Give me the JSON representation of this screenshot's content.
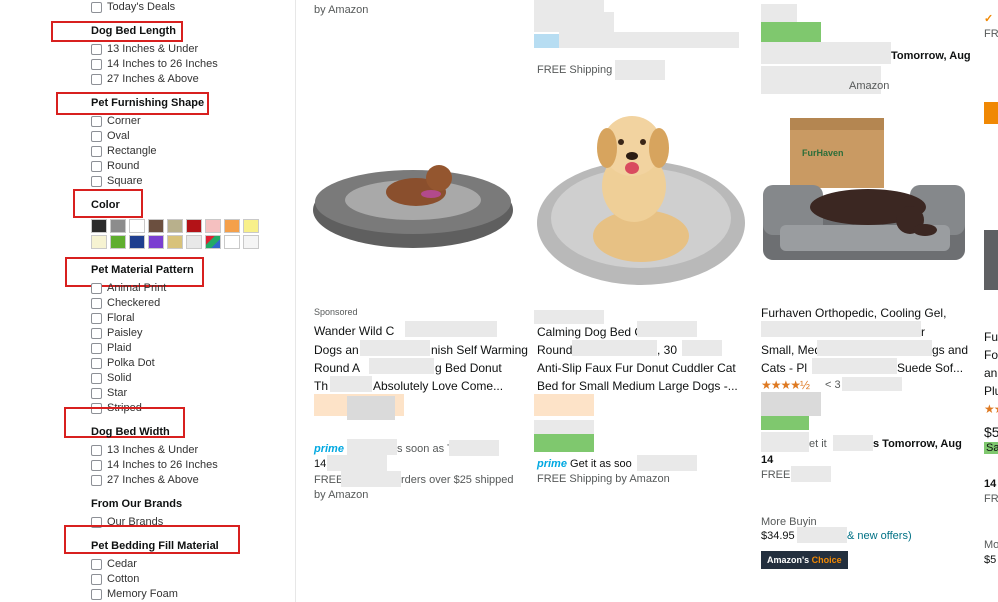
{
  "sidebar": {
    "top_item": "Today's Deals",
    "dog_bed_length": {
      "title": "Dog Bed Length",
      "options": [
        "13 Inches & Under",
        "14 Inches to 26 Inches",
        "27 Inches & Above"
      ]
    },
    "pet_furnishing_shape": {
      "title": "Pet Furnishing Shape",
      "options": [
        "Corner",
        "Oval",
        "Rectangle",
        "Round",
        "Square"
      ]
    },
    "color": {
      "title": "Color",
      "swatches_row1": [
        "#2b2b2b",
        "#8c8c8c",
        "#ffffff",
        "#6b4f3f",
        "#b8b08c",
        "#b31217",
        "#f5c0c0",
        "#f4a04a",
        "#f8f08a"
      ],
      "swatches_row2": [
        "#f6f3d2",
        "#5fae2e",
        "#1f3f8f",
        "#7a3fd1",
        "#d8c27a",
        "#e8e8e8",
        "#multi",
        "#ffffff",
        "#f5f5f5"
      ]
    },
    "pet_material_pattern": {
      "title": "Pet Material Pattern",
      "options": [
        "Animal Print",
        "Checkered",
        "Floral",
        "Paisley",
        "Plaid",
        "Polka Dot",
        "Solid",
        "Star",
        "Striped"
      ]
    },
    "dog_bed_width": {
      "title": "Dog Bed Width",
      "options": [
        "13 Inches & Under",
        "14 Inches to 26 Inches",
        "27 Inches & Above"
      ]
    },
    "from_our_brands": {
      "title": "From Our Brands",
      "options": [
        "Our Brands"
      ]
    },
    "pet_bedding_fill_material": {
      "title": "Pet Bedding Fill Material",
      "options": [
        "Cedar",
        "Cotton",
        "Memory Foam"
      ]
    }
  },
  "results": {
    "card1": {
      "top_text": "by Amazon",
      "sponsored": "Sponsored",
      "title_lines": [
        "Wander Wild C",
        "Dogs an",
        "nish Self Warming",
        "Round A",
        "g Bed Donut",
        "Th",
        "Absolutely Love Come..."
      ],
      "prime_suffix": "s soon as T",
      "date_num": "14",
      "shipping": "FREE",
      "shipping_tail": "rders over $25 shipped",
      "by": "by Amazon",
      "prime": "prime"
    },
    "card2": {
      "top_shipping": "FREE Shipping by",
      "title_lines": [
        "Calming Dog Bed C",
        "Round",
        ", 30",
        "Anti-Slip Faux Fur Donut Cuddler Cat",
        "Bed for Small Medium Large Dogs -..."
      ],
      "prime": "prime",
      "get_it": "Get it as soo",
      "shipping": "FREE Shipping by Amazon"
    },
    "card3": {
      "top_date": "Tomorrow, Aug",
      "top_amazon": "Amazon",
      "title_lines": [
        "Furhaven Orthopedic, Cooling Gel,",
        "r",
        "Small, Medi",
        "gs and",
        "Cats - Pl",
        "Suede Sof..."
      ],
      "rating_count": "< 3",
      "get_it": "et it",
      "get_it_tail": "s Tomorrow, Aug",
      "date_num": "14",
      "free": "FREE S",
      "more_buying": "More Buyin",
      "price": "$34.95",
      "offers": "& new offers)",
      "badge_prefix": "Amazon's",
      "badge_choice": "Choice",
      "box_brand": "FurHaven"
    },
    "card4": {
      "top_fre": "FRE",
      "title_fragments": [
        "Fur",
        "Foa",
        "an",
        "Plu"
      ],
      "price_prefix": "$5",
      "sale": "Sa",
      "date_num": "14",
      "fre2": "FRE",
      "mo": "Mo",
      "price2": "$5"
    }
  }
}
